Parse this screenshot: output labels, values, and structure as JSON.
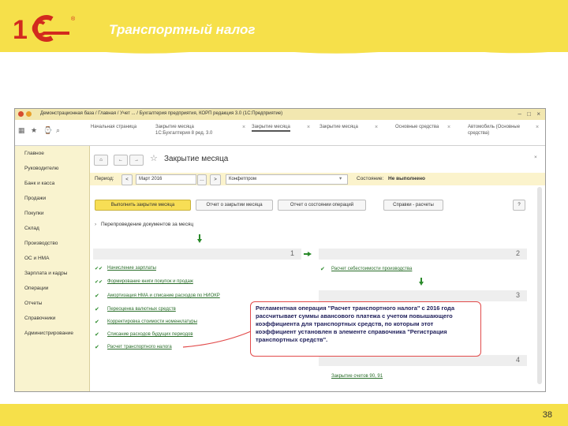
{
  "slide": {
    "title": "Транспортный налог",
    "page_number": "38",
    "brand_color": "#f6e04a",
    "logo_text": "1С"
  },
  "window": {
    "title": "Демонстрационная база / Главная / Учет ... / Бухгалтерия предприятия, КОРП редакция 3.0 (1С:Предприятие)",
    "tabs": [
      {
        "label": "Начальная страница"
      },
      {
        "label": "Закрытие месяца",
        "sub": "1С:Бухгалтерия 8 ред. 3.0"
      },
      {
        "label": "Закрытие месяца"
      },
      {
        "label": "Закрытие месяца"
      },
      {
        "label": "Основные средства"
      },
      {
        "label": "Автомобиль (Основные средства)"
      }
    ],
    "sidebar": [
      "Главное",
      "Руководителю",
      "Банк и касса",
      "Продажи",
      "Покупки",
      "Склад",
      "Производство",
      "ОС и НМА",
      "Зарплата и кадры",
      "Операции",
      "Отчеты",
      "Справочники",
      "Администрирование"
    ],
    "content": {
      "title": "Закрытие месяца",
      "period_label": "Период:",
      "period_value": "Март 2016",
      "org_value": "Конфетпром",
      "status_label": "Состояние:",
      "status_value": "Не выполнено",
      "buttons": {
        "run": "Выполнить закрытие месяца",
        "report": "Отчет о закрытии месяца",
        "state": "Отчет о состоянии операций",
        "help": "Справки - расчеты",
        "question": "?"
      },
      "reposting": "Перепроведение документов за месяц",
      "sections": [
        "1",
        "2",
        "3",
        "4"
      ],
      "ops_left": [
        "Начисление зарплаты",
        "Формирование книги покупок и продаж",
        "Амортизация НМА и списание расходов по НИОКР",
        "Переоценка валютных средств",
        "Корректировка стоимости номенклатуры",
        "Списание расходов будущих периодов",
        "Расчет транспортного налога"
      ],
      "op_right": "Расчет себестоимости производства",
      "op_bottom": "Закрытие счетов 90, 91"
    }
  },
  "callout": {
    "text": "Регламентная операция \"Расчет транспортного налога\" с 2016 года рассчитывает суммы авансового платежа с учетом повышающего коэффициента для транспортных средств, по которым этот коэффициент установлен в элементе справочника \"Регистрация транспортных средств\"."
  }
}
